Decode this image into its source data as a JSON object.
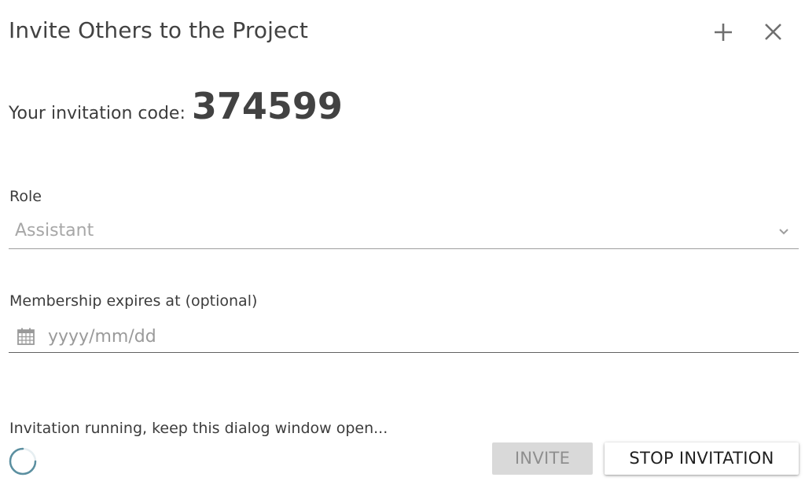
{
  "dialog": {
    "title": "Invite Others to the Project",
    "header_icons": [
      "plus-icon",
      "close-icon"
    ]
  },
  "invitation": {
    "code_label": "Your invitation code:",
    "code": "374599"
  },
  "role": {
    "label": "Role",
    "selected": "Assistant",
    "icon": "chevron-down-icon"
  },
  "expiry": {
    "label": "Membership expires at (optional)",
    "placeholder": "yyyy/mm/dd",
    "value": "",
    "icon": "calendar-icon"
  },
  "status": {
    "message": "Invitation running, keep this dialog window open..."
  },
  "actions": {
    "invite_label": "INVITE",
    "invite_enabled": false,
    "stop_label": "STOP INVITATION"
  },
  "colors": {
    "spinner": "#5b8fa0",
    "disabled_button_bg": "#d9d9d9",
    "text": "#3c3c3c"
  }
}
